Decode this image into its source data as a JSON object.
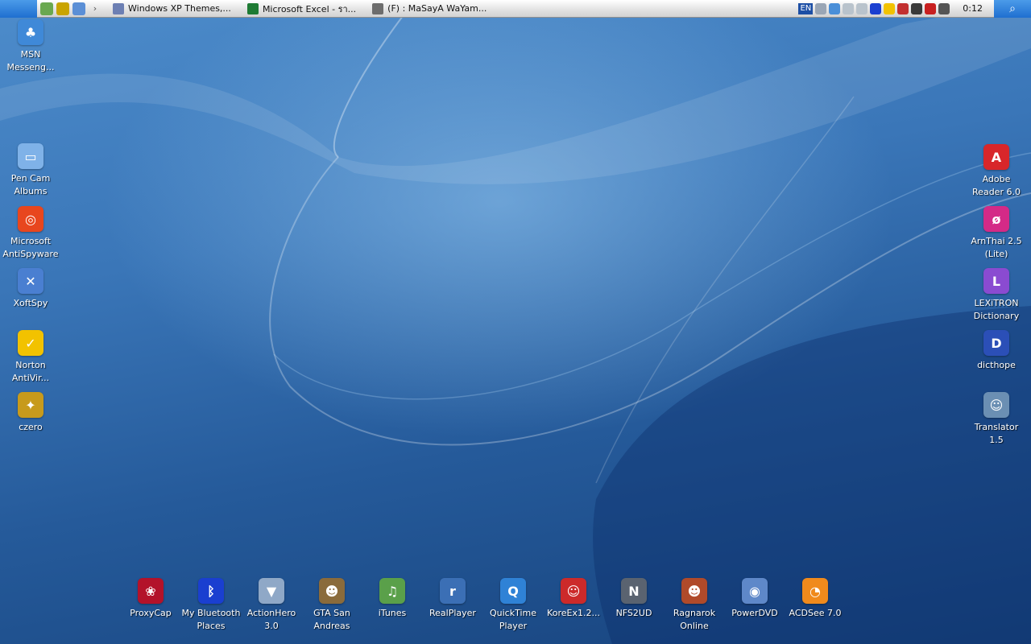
{
  "taskbar": {
    "apple_menu_icon": "apple-logo-icon",
    "quick_launch": [
      {
        "name": "itunes-quicklaunch-icon",
        "color": "#6aa84f"
      },
      {
        "name": "media-quicklaunch-icon",
        "color": "#c9a400"
      },
      {
        "name": "msn-quicklaunch-icon",
        "color": "#5b8fd6"
      }
    ],
    "overflow_arrow": "›",
    "tasks": [
      {
        "label": "Windows XP Themes,...",
        "icon": "document-icon",
        "color": "#6c7fb3"
      },
      {
        "label": "Microsoft Excel - รา...",
        "icon": "excel-icon",
        "color": "#1e7b34"
      },
      {
        "label": "(F) : MaSayA WaYam...",
        "icon": "folder-icon",
        "color": "#6d6d6d"
      }
    ],
    "tray": {
      "language": "EN",
      "icons": [
        "expand-icon",
        "msn-status-icon",
        "network-icon",
        "network-icon",
        "bluetooth-icon",
        "norton-icon",
        "speaker-icon",
        "power-icon",
        "display-icon",
        "network-monitor-icon"
      ],
      "clock": "0:12"
    },
    "search_icon": "search-icon"
  },
  "desktop_left": [
    {
      "name": "msn-messenger",
      "label": "MSN\nMesseng...",
      "icon": "msn-icon",
      "color": "#3f89d8",
      "glyph": "♣"
    },
    {
      "name": "pen-cam-albums",
      "label": "Pen Cam\nAlbums",
      "icon": "folder-icon",
      "color": "#7fb2e8",
      "glyph": "▭"
    },
    {
      "name": "microsoft-antispyware",
      "label": "Microsoft\nAntiSpyware",
      "icon": "antispyware-icon",
      "color": "#e8461e",
      "glyph": "◎"
    },
    {
      "name": "xoftspy",
      "label": "XoftSpy",
      "icon": "xoftspy-icon",
      "color": "#4a7fd1",
      "glyph": "✕"
    },
    {
      "name": "norton-antivirus",
      "label": "Norton\nAntiVir...",
      "icon": "norton-icon",
      "color": "#f2c200",
      "glyph": "✓"
    },
    {
      "name": "czero",
      "label": "czero",
      "icon": "counter-strike-icon",
      "color": "#c79a1c",
      "glyph": "✦"
    }
  ],
  "desktop_right": [
    {
      "name": "adobe-reader",
      "label": "Adobe\nReader 6.0",
      "icon": "adobe-reader-icon",
      "color": "#d8262a",
      "glyph": "A"
    },
    {
      "name": "arnthai",
      "label": "ArnThai 2.5\n(Lite)",
      "icon": "arnthai-icon",
      "color": "#d42a87",
      "glyph": "ø"
    },
    {
      "name": "lexitron",
      "label": "LEXiTRON\nDictionary",
      "icon": "lexitron-icon",
      "color": "#8a4bd1",
      "glyph": "L"
    },
    {
      "name": "dicthope",
      "label": "dicthope",
      "icon": "dicthope-icon",
      "color": "#2b4fb7",
      "glyph": "D"
    },
    {
      "name": "translator",
      "label": "Translator\n1.5",
      "icon": "translator-icon",
      "color": "#6b8fb3",
      "glyph": "☺"
    }
  ],
  "dock": [
    {
      "name": "proxycap",
      "label": "ProxyCap",
      "icon": "proxycap-icon",
      "color": "#b3122a",
      "glyph": "❀"
    },
    {
      "name": "my-bluetooth-places",
      "label": "My Bluetooth\nPlaces",
      "icon": "bluetooth-icon",
      "color": "#1a3fd0",
      "glyph": "ᛒ"
    },
    {
      "name": "actionhero",
      "label": "ActionHero\n3.0",
      "icon": "actionhero-icon",
      "color": "#8fa8c7",
      "glyph": "▼"
    },
    {
      "name": "gta-san-andreas",
      "label": "GTA San\nAndreas",
      "icon": "gta-icon",
      "color": "#8a6b3b",
      "glyph": "☻"
    },
    {
      "name": "itunes",
      "label": "iTunes",
      "icon": "itunes-icon",
      "color": "#5aa04a",
      "glyph": "♫"
    },
    {
      "name": "realplayer",
      "label": "RealPlayer",
      "icon": "realplayer-icon",
      "color": "#3b6fb5",
      "glyph": "r"
    },
    {
      "name": "quicktime-player",
      "label": "QuickTime\nPlayer",
      "icon": "quicktime-icon",
      "color": "#2f82d6",
      "glyph": "Q"
    },
    {
      "name": "koreex",
      "label": "KoreEx1.2...",
      "icon": "koreex-icon",
      "color": "#cc2a2a",
      "glyph": "☺"
    },
    {
      "name": "nfs2ud",
      "label": "NFS2UD",
      "icon": "nfs-icon",
      "color": "#5a6370",
      "glyph": "N"
    },
    {
      "name": "ragnarok-online",
      "label": "Ragnarok\nOnline",
      "icon": "ragnarok-icon",
      "color": "#b04a2a",
      "glyph": "☻"
    },
    {
      "name": "powerdvd",
      "label": "PowerDVD",
      "icon": "powerdvd-icon",
      "color": "#5e88c9",
      "glyph": "◉"
    },
    {
      "name": "acdsee",
      "label": "ACDSee 7.0",
      "icon": "acdsee-icon",
      "color": "#f08a1c",
      "glyph": "◔"
    }
  ]
}
